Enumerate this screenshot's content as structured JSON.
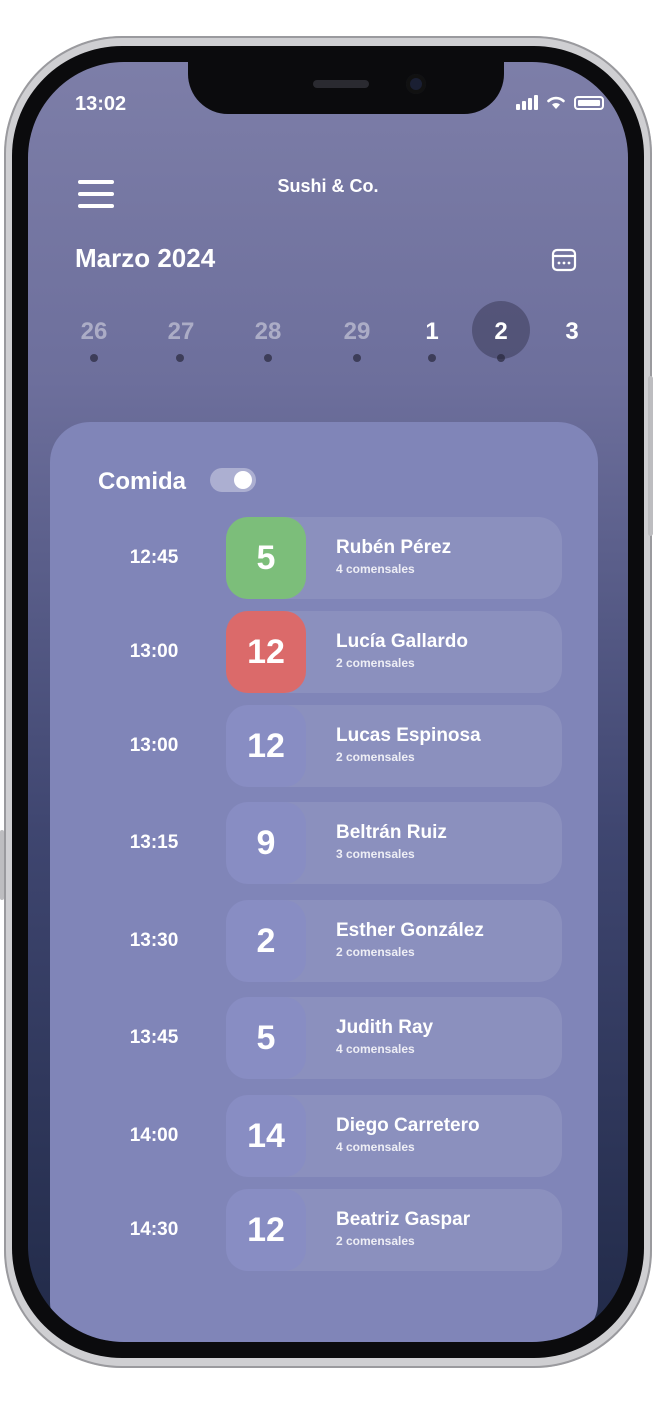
{
  "status": {
    "time": "13:02"
  },
  "header": {
    "title": "Sushi & Co."
  },
  "calendar": {
    "month": "Marzo 2024",
    "days": [
      "26",
      "27",
      "28",
      "29",
      "1",
      "2",
      "3"
    ],
    "selected": "2"
  },
  "section": {
    "title": "Comida",
    "toggle_on": true
  },
  "reservations": [
    {
      "time": "12:45",
      "table": "5",
      "name": "Rubén Pérez",
      "guests": "4 comensales",
      "status_color": "#7cbe7a"
    },
    {
      "time": "13:00",
      "table": "12",
      "name": "Lucía Gallardo",
      "guests": "2 comensales",
      "status_color": "#db6a6a"
    },
    {
      "time": "13:00",
      "table": "12",
      "name": "Lucas Espinosa",
      "guests": "2 comensales",
      "status_color": ""
    },
    {
      "time": "13:15",
      "table": "9",
      "name": "Beltrán Ruiz",
      "guests": "3 comensales",
      "status_color": ""
    },
    {
      "time": "13:30",
      "table": "2",
      "name": "Esther González",
      "guests": "2 comensales",
      "status_color": ""
    },
    {
      "time": "13:45",
      "table": "5",
      "name": "Judith Ray",
      "guests": "4 comensales",
      "status_color": ""
    },
    {
      "time": "14:00",
      "table": "14",
      "name": "Diego Carretero",
      "guests": "4 comensales",
      "status_color": ""
    },
    {
      "time": "14:30",
      "table": "12",
      "name": "Beatriz Gaspar",
      "guests": "2 comensales",
      "status_color": ""
    }
  ],
  "colors": {
    "panel": "#8085b8",
    "tile_default": "#888dc3",
    "confirmed": "#7cbe7a",
    "alert": "#db6a6a"
  }
}
